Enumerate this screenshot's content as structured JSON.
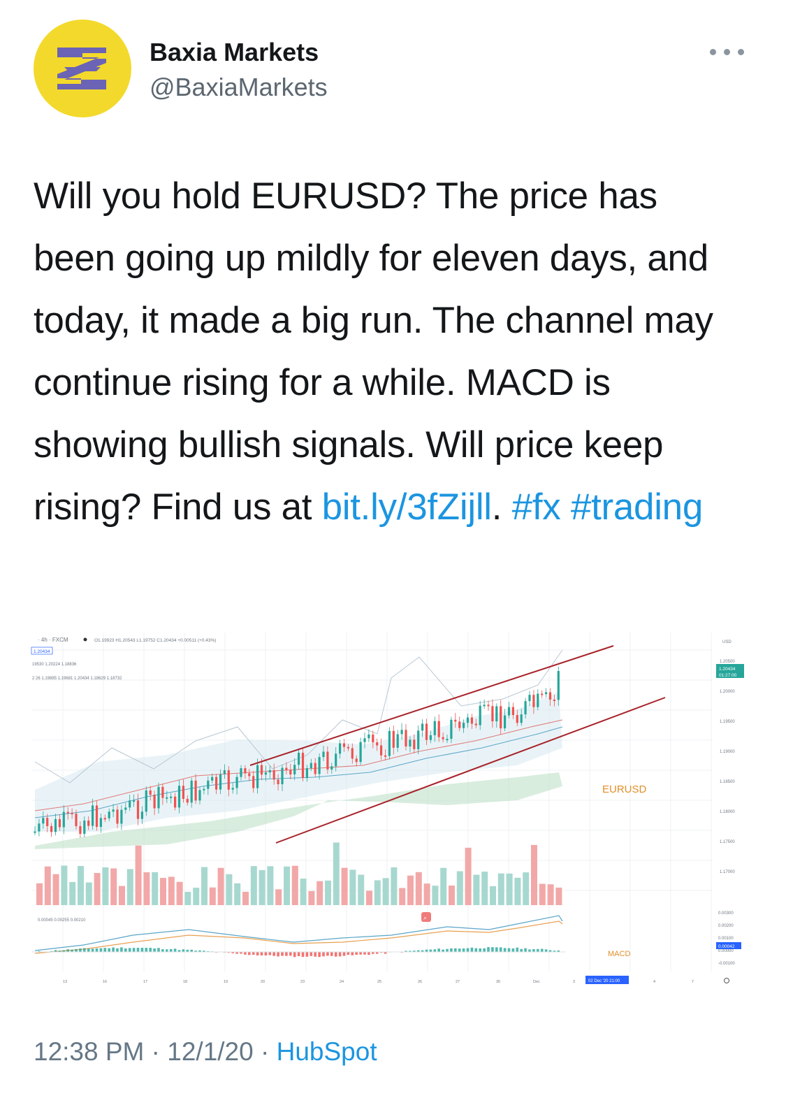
{
  "account": {
    "name": "Baxia Markets",
    "handle": "@BaxiaMarkets",
    "avatar_icon": "baxia-z-logo",
    "avatar_color": "#f3d92b",
    "logo_color": "#6b63b5"
  },
  "tweet": {
    "text_before": "Will you hold EURUSD? The price has been going up mildly for eleven days, and today, it made a big run. The channel may continue rising for a while. MACD is showing bullish signals. Will price keep rising? Find us at ",
    "link": "bit.ly/3fZijll",
    "after_link": ". ",
    "hashtag1": "#fx",
    "space": " ",
    "hashtag2": "#trading",
    "link_color": "#1b95e0"
  },
  "chart_image": {
    "header": {
      "symbol_line": "· 4h · FXCM",
      "ohlc": "O1.19923 H1.20543 L1.19752 C1.20434 +0.00511 (+0.43%)",
      "price_box": "1.20434",
      "line2": "19530 1.20224 1.18836",
      "line3": "2 26 1.19885 1.19681 1.20434 1.18629 1.18732",
      "currency": "USD"
    },
    "current_price_tag": "1.20434",
    "current_time_tag": "01:27:00",
    "price_axis": [
      "1.20500",
      "1.20000",
      "1.19500",
      "1.19000",
      "1.18500",
      "1.18000",
      "1.17500",
      "1.17000"
    ],
    "macd_axis": [
      "0.00300",
      "0.00200",
      "0.00100",
      "0.00000",
      "-0.00100"
    ],
    "macd_tag": "0.00042",
    "macd_header": "0.00045 0.00255 0.00210",
    "labels": {
      "price": "EURUSD",
      "macd": "MACD"
    },
    "time_axis": [
      "13",
      "16",
      "17",
      "18",
      "19",
      "20",
      "23",
      "24",
      "25",
      "26",
      "27",
      "30",
      "Dec",
      "2",
      "4",
      "7"
    ],
    "time_cursor": "02 Dec '20  21:00",
    "colors": {
      "up": "#26a69a",
      "down": "#ef5350",
      "trendline": "#a8232a",
      "label": "#e0902a"
    }
  },
  "footer": {
    "time": "12:38 PM",
    "sep1": " · ",
    "date": "12/1/20",
    "sep2": " · ",
    "source": "HubSpot"
  }
}
